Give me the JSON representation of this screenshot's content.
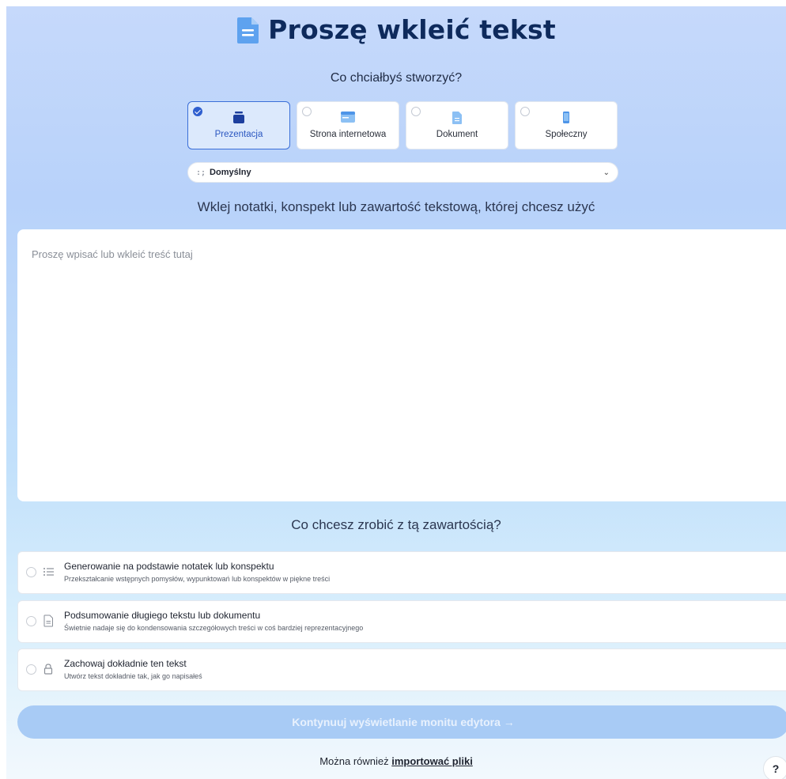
{
  "header": {
    "title": "Proszę wkleić tekst",
    "title_icon": "document-icon",
    "subtitle": "Co chciałbyś stworzyć?"
  },
  "types": [
    {
      "label": "Prezentacja",
      "icon": "presentation-icon",
      "selected": true
    },
    {
      "label": "Strona internetowa",
      "icon": "webpage-icon",
      "selected": false
    },
    {
      "label": "Dokument",
      "icon": "document-icon",
      "selected": false
    },
    {
      "label": "Społeczny",
      "icon": "phone-icon",
      "selected": false
    }
  ],
  "theme": {
    "icon_text": ":;",
    "value": "Domyślny"
  },
  "prompt": {
    "label": "Wklej notatki, konspekt lub zawartość tekstową, której chcesz użyć",
    "placeholder": "Proszę wpisać lub wkleić treść tutaj"
  },
  "actions": {
    "label": "Co chcesz zrobić z tą zawartością?",
    "options": [
      {
        "title": "Generowanie na podstawie notatek lub konspektu",
        "desc": "Przekształcanie wstępnych pomysłów, wypunktowań lub konspektów w piękne treści",
        "icon": "list-icon"
      },
      {
        "title": "Podsumowanie długiego tekstu lub dokumentu",
        "desc": "Świetnie nadaje się do kondensowania szczegółowych treści w coś bardziej reprezentacyjnego",
        "icon": "file-icon"
      },
      {
        "title": "Zachowaj dokładnie ten tekst",
        "desc": "Utwórz tekst dokładnie tak, jak go napisałeś",
        "icon": "lock-icon"
      }
    ]
  },
  "footer": {
    "continue_label": "Kontynuuj wyświetlanie monitu edytora →",
    "import_prefix": "Można również ",
    "import_link": "importować pliki",
    "help_label": "?"
  },
  "colors": {
    "accent": "#2f5fcf",
    "title": "#0e2a5c",
    "button_disabled": "#a8cbf5"
  }
}
